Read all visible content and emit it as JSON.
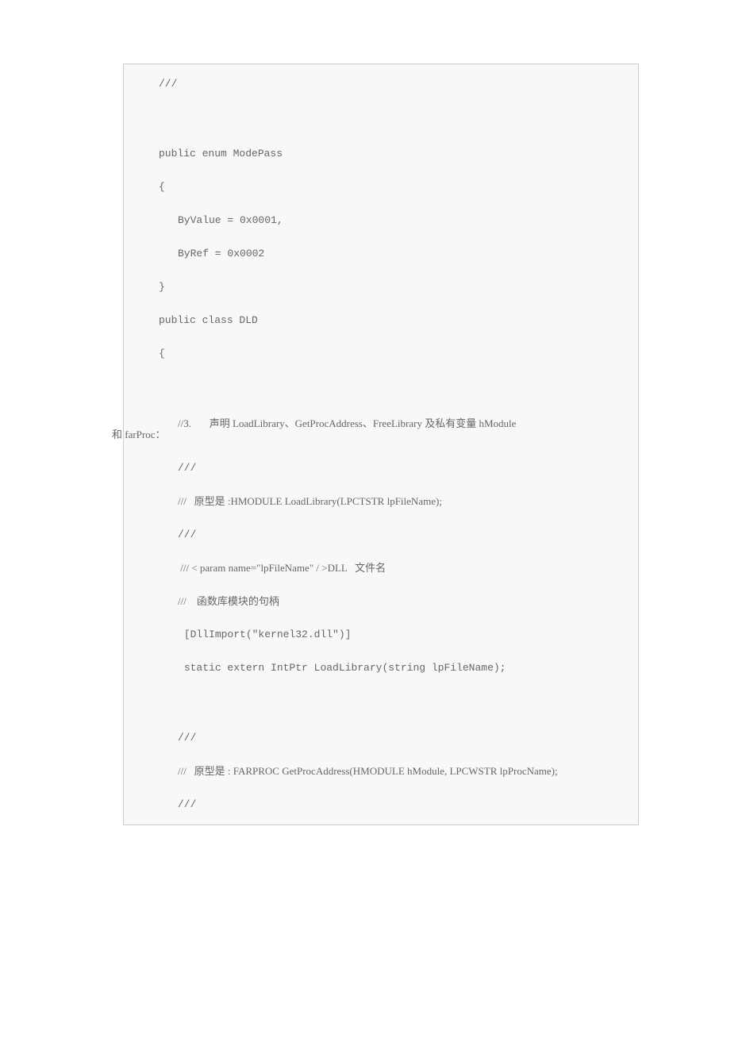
{
  "code": {
    "l1": "///",
    "l2": "public enum ModePass",
    "l3": "{",
    "l4": "ByValue = 0x0001,",
    "l5": "ByRef = 0x0002",
    "l6": "}",
    "l7": "public class DLD",
    "l8": "{",
    "l9a": "//3.       声明 LoadLibrary、GetProcAddress、FreeLibrary 及私有变量 hModule",
    "l9b": "和 farProc：",
    "l10": "///",
    "l11": "///   原型是 :HMODULE LoadLibrary(LPCTSTR lpFileName);",
    "l12": "///",
    "l13": " /// < param name=\"lpFileName\" / >DLL   文件名",
    "l14": "///    函数库模块的句柄",
    "l15": " [DllImport(\"kernel32.dll\")]",
    "l16": " static extern IntPtr LoadLibrary(string lpFileName);",
    "l17": "///",
    "l18": "///   原型是 : FARPROC GetProcAddress(HMODULE hModule, LPCWSTR lpProcName);",
    "l19": "///"
  }
}
